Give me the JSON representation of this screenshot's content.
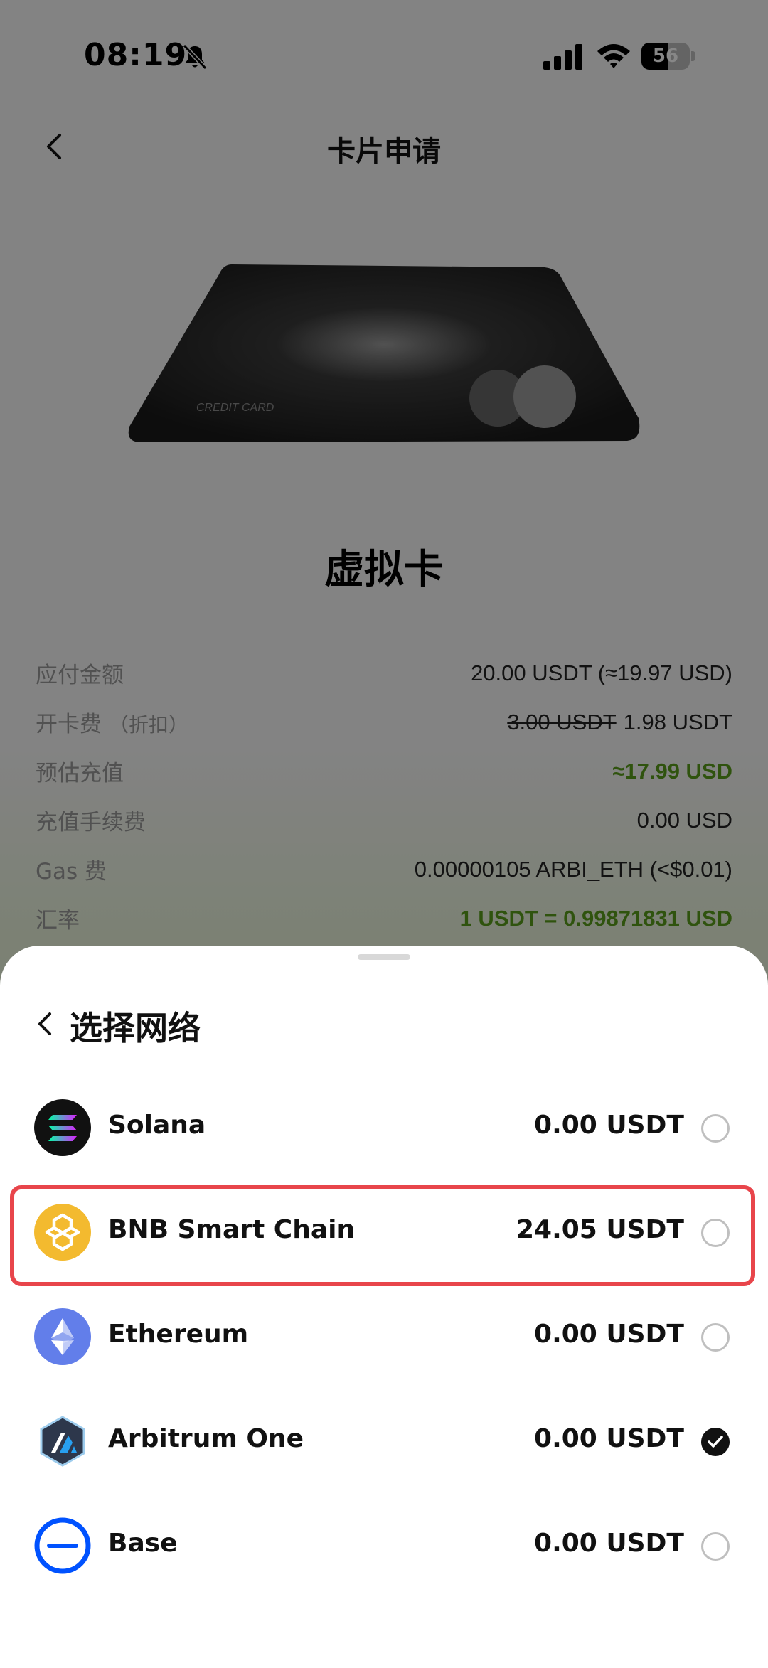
{
  "status_bar": {
    "time": "08:19",
    "battery_level": "56",
    "battery_fraction": 0.56
  },
  "nav": {
    "title": "卡片申请"
  },
  "card": {
    "card_text": "CREDIT CARD",
    "name": "虚拟卡"
  },
  "summary": {
    "rows": [
      {
        "label": "应付金额",
        "sub": "",
        "value": "20.00 USDT (≈19.97 USD)"
      },
      {
        "label": "开卡费",
        "sub": "（折扣）",
        "strike": "3.00 USDT",
        "value": "1.98 USDT"
      },
      {
        "label": "预估充值",
        "sub": "",
        "value": "≈17.99 USD"
      },
      {
        "label": "充值手续费",
        "sub": "",
        "value": "0.00 USD"
      },
      {
        "label": "Gas 费",
        "sub": "",
        "value": "0.00000105 ARBI_ETH (<$0.01)"
      },
      {
        "label": "汇率",
        "sub": "",
        "value": "1 USDT = 0.99871831 USD"
      }
    ]
  },
  "sheet": {
    "title": "选择网络",
    "networks": [
      {
        "name": "Solana",
        "balance": "0.00 USDT",
        "icon": "solana-icon",
        "selected": false
      },
      {
        "name": "BNB Smart Chain",
        "balance": "24.05 USDT",
        "icon": "bnb-icon",
        "selected": false,
        "highlighted": true
      },
      {
        "name": "Ethereum",
        "balance": "0.00 USDT",
        "icon": "ethereum-icon",
        "selected": false
      },
      {
        "name": "Arbitrum One",
        "balance": "0.00 USDT",
        "icon": "arbitrum-icon",
        "selected": true
      },
      {
        "name": "Base",
        "balance": "0.00 USDT",
        "icon": "base-icon",
        "selected": false
      }
    ]
  },
  "colors": {
    "accent_green": "#5a9e1c",
    "highlight_red": "#e8454b",
    "bnb_yellow": "#f3ba2f",
    "eth_blue": "#627eea",
    "base_blue": "#0052ff"
  }
}
